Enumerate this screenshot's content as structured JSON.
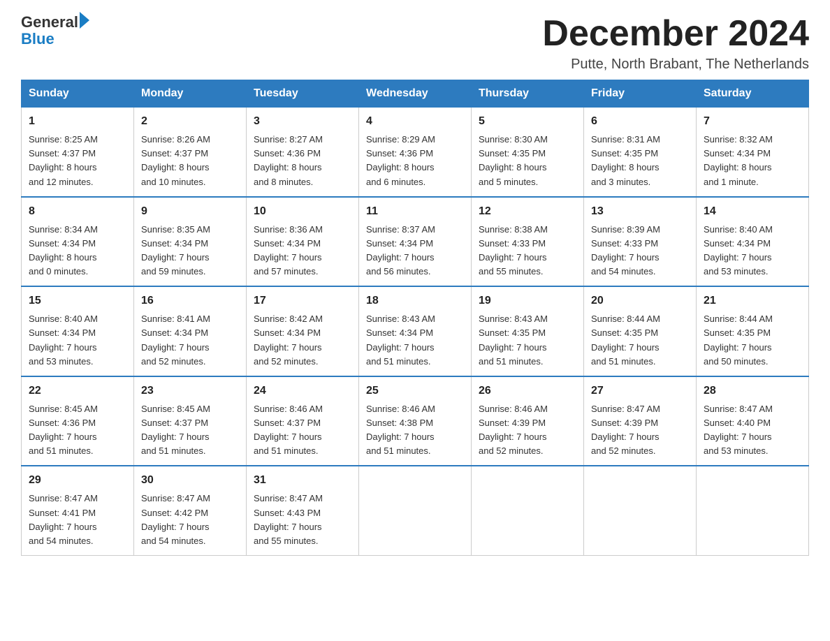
{
  "header": {
    "logo": {
      "general": "General",
      "blue": "Blue"
    },
    "title": "December 2024",
    "location": "Putte, North Brabant, The Netherlands"
  },
  "weekdays": [
    "Sunday",
    "Monday",
    "Tuesday",
    "Wednesday",
    "Thursday",
    "Friday",
    "Saturday"
  ],
  "weeks": [
    [
      {
        "day": "1",
        "info": "Sunrise: 8:25 AM\nSunset: 4:37 PM\nDaylight: 8 hours\nand 12 minutes."
      },
      {
        "day": "2",
        "info": "Sunrise: 8:26 AM\nSunset: 4:37 PM\nDaylight: 8 hours\nand 10 minutes."
      },
      {
        "day": "3",
        "info": "Sunrise: 8:27 AM\nSunset: 4:36 PM\nDaylight: 8 hours\nand 8 minutes."
      },
      {
        "day": "4",
        "info": "Sunrise: 8:29 AM\nSunset: 4:36 PM\nDaylight: 8 hours\nand 6 minutes."
      },
      {
        "day": "5",
        "info": "Sunrise: 8:30 AM\nSunset: 4:35 PM\nDaylight: 8 hours\nand 5 minutes."
      },
      {
        "day": "6",
        "info": "Sunrise: 8:31 AM\nSunset: 4:35 PM\nDaylight: 8 hours\nand 3 minutes."
      },
      {
        "day": "7",
        "info": "Sunrise: 8:32 AM\nSunset: 4:34 PM\nDaylight: 8 hours\nand 1 minute."
      }
    ],
    [
      {
        "day": "8",
        "info": "Sunrise: 8:34 AM\nSunset: 4:34 PM\nDaylight: 8 hours\nand 0 minutes."
      },
      {
        "day": "9",
        "info": "Sunrise: 8:35 AM\nSunset: 4:34 PM\nDaylight: 7 hours\nand 59 minutes."
      },
      {
        "day": "10",
        "info": "Sunrise: 8:36 AM\nSunset: 4:34 PM\nDaylight: 7 hours\nand 57 minutes."
      },
      {
        "day": "11",
        "info": "Sunrise: 8:37 AM\nSunset: 4:34 PM\nDaylight: 7 hours\nand 56 minutes."
      },
      {
        "day": "12",
        "info": "Sunrise: 8:38 AM\nSunset: 4:33 PM\nDaylight: 7 hours\nand 55 minutes."
      },
      {
        "day": "13",
        "info": "Sunrise: 8:39 AM\nSunset: 4:33 PM\nDaylight: 7 hours\nand 54 minutes."
      },
      {
        "day": "14",
        "info": "Sunrise: 8:40 AM\nSunset: 4:34 PM\nDaylight: 7 hours\nand 53 minutes."
      }
    ],
    [
      {
        "day": "15",
        "info": "Sunrise: 8:40 AM\nSunset: 4:34 PM\nDaylight: 7 hours\nand 53 minutes."
      },
      {
        "day": "16",
        "info": "Sunrise: 8:41 AM\nSunset: 4:34 PM\nDaylight: 7 hours\nand 52 minutes."
      },
      {
        "day": "17",
        "info": "Sunrise: 8:42 AM\nSunset: 4:34 PM\nDaylight: 7 hours\nand 52 minutes."
      },
      {
        "day": "18",
        "info": "Sunrise: 8:43 AM\nSunset: 4:34 PM\nDaylight: 7 hours\nand 51 minutes."
      },
      {
        "day": "19",
        "info": "Sunrise: 8:43 AM\nSunset: 4:35 PM\nDaylight: 7 hours\nand 51 minutes."
      },
      {
        "day": "20",
        "info": "Sunrise: 8:44 AM\nSunset: 4:35 PM\nDaylight: 7 hours\nand 51 minutes."
      },
      {
        "day": "21",
        "info": "Sunrise: 8:44 AM\nSunset: 4:35 PM\nDaylight: 7 hours\nand 50 minutes."
      }
    ],
    [
      {
        "day": "22",
        "info": "Sunrise: 8:45 AM\nSunset: 4:36 PM\nDaylight: 7 hours\nand 51 minutes."
      },
      {
        "day": "23",
        "info": "Sunrise: 8:45 AM\nSunset: 4:37 PM\nDaylight: 7 hours\nand 51 minutes."
      },
      {
        "day": "24",
        "info": "Sunrise: 8:46 AM\nSunset: 4:37 PM\nDaylight: 7 hours\nand 51 minutes."
      },
      {
        "day": "25",
        "info": "Sunrise: 8:46 AM\nSunset: 4:38 PM\nDaylight: 7 hours\nand 51 minutes."
      },
      {
        "day": "26",
        "info": "Sunrise: 8:46 AM\nSunset: 4:39 PM\nDaylight: 7 hours\nand 52 minutes."
      },
      {
        "day": "27",
        "info": "Sunrise: 8:47 AM\nSunset: 4:39 PM\nDaylight: 7 hours\nand 52 minutes."
      },
      {
        "day": "28",
        "info": "Sunrise: 8:47 AM\nSunset: 4:40 PM\nDaylight: 7 hours\nand 53 minutes."
      }
    ],
    [
      {
        "day": "29",
        "info": "Sunrise: 8:47 AM\nSunset: 4:41 PM\nDaylight: 7 hours\nand 54 minutes."
      },
      {
        "day": "30",
        "info": "Sunrise: 8:47 AM\nSunset: 4:42 PM\nDaylight: 7 hours\nand 54 minutes."
      },
      {
        "day": "31",
        "info": "Sunrise: 8:47 AM\nSunset: 4:43 PM\nDaylight: 7 hours\nand 55 minutes."
      },
      {
        "day": "",
        "info": ""
      },
      {
        "day": "",
        "info": ""
      },
      {
        "day": "",
        "info": ""
      },
      {
        "day": "",
        "info": ""
      }
    ]
  ]
}
